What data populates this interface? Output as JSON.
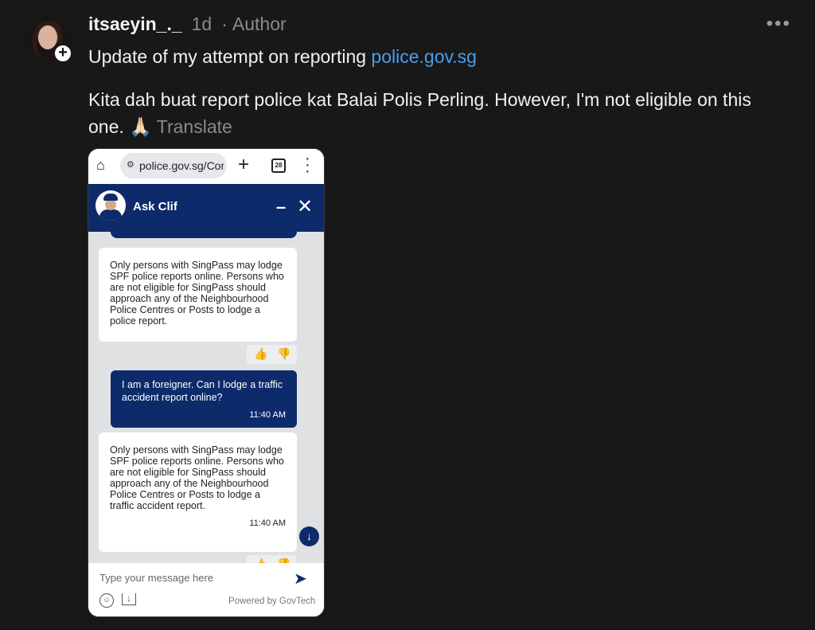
{
  "post": {
    "username": "itsaeyin_._",
    "time": "1d",
    "separator": "·",
    "author_label": "Author",
    "more_icon": "more-horizontal-icon",
    "follow_icon": "plus-icon",
    "follow_symbol": "+",
    "line1_prefix": "Update of my attempt on reporting ",
    "line1_link": "police.gov.sg",
    "body": "Kita dah buat report police kat Balai Polis Perling. However, I'm not eligible on this one. 🙏🏻",
    "translate_label": "Translate"
  },
  "screenshot": {
    "browser": {
      "url": "police.gov.sg/Cor",
      "tab_count": "28"
    },
    "chat": {
      "bot_name": "Ask Clif",
      "messages": [
        {
          "sender": "bot",
          "text": "Only persons with SingPass may lodge SPF police reports online. Persons who are not eligible for SingPass should approach any of the Neighbourhood Police Centres or Posts to lodge a police report.",
          "time": ""
        },
        {
          "sender": "user",
          "text": "I am a foreigner. Can I lodge a traffic accident report online?",
          "time": "11:40 AM"
        },
        {
          "sender": "bot",
          "text": "Only persons with SingPass may lodge SPF police reports online. Persons who are not eligible for SingPass should approach any of the Neighbourhood Police Centres or Posts to lodge a traffic accident report.",
          "time": "11:40 AM"
        }
      ],
      "input_placeholder": "Type your message here",
      "powered_by": "Powered by GovTech"
    }
  },
  "colors": {
    "background": "#181818",
    "link": "#4a9ee8",
    "chat_navy": "#0d2a6a"
  }
}
